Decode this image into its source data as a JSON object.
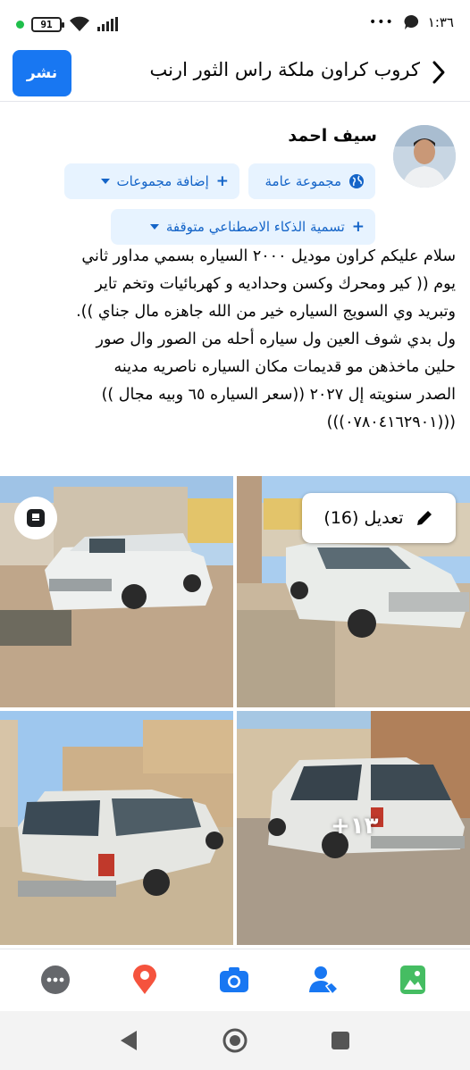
{
  "status_bar": {
    "battery": "91",
    "time": "١:٣٦"
  },
  "header": {
    "title": "كروب كراون ملكة راس الثور ارنب",
    "publish_label": "نشر"
  },
  "author": {
    "name": "سيف احمد"
  },
  "audience": {
    "group_privacy": "مجموعة عامة",
    "add_groups": "إضافة مجموعات",
    "ai_label": "تسمية الذكاء الاصطناعي متوقفة"
  },
  "post": {
    "lines": [
      "سلام عليكم كراون موديل ٢٠٠٠ السياره  بسمي مداور ثاني",
      "يوم (( كير ومحرك وكسن وحداديه و  كهربائيات وتخم تاير",
      "وتبريد وي السويج السياره خير من الله جاهزه مال جناي )).",
      "ول بدي شوف العين ول سياره أحله من الصور وال صور",
      "حلين ماخذهن مو قديمات مكان السياره ناصريه مدينه",
      "الصدر سنويته إل ٢٠٢٧ ((سعر السياره ٦٥ وبيه مجال ))",
      "(((٠٧٨٠٤١٦٢٩٠١)))"
    ]
  },
  "photos": {
    "edit_label": "تعديل (16)",
    "more_count": "+١٣"
  },
  "toolbar": {
    "items": [
      "more-icon",
      "location-icon",
      "camera-icon",
      "tag-people-icon",
      "photo-icon"
    ]
  },
  "colors": {
    "accent": "#1877f2",
    "pill_bg": "#e7f3ff",
    "pill_text": "#1464c8"
  }
}
